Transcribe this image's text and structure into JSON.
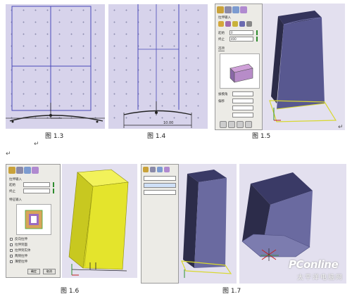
{
  "captions": {
    "fig13": "图 1.3",
    "fig14": "图 1.4",
    "fig15": "图 1.5",
    "fig16": "图 1.6",
    "fig17": "图 1.7"
  },
  "dimension_14": "10.00",
  "panel_15": {
    "sec_top": "拉伸输入",
    "label1": "起始",
    "label2": "终止",
    "value1": "0",
    "value2": "400",
    "tab": "选项",
    "row1": "拔模角",
    "row2": "偏移"
  },
  "panel_16": {
    "sec_top": "拉伸输入",
    "label1": "起始",
    "label2": "终止",
    "section_shape": "特征输入",
    "checkboxes": [
      "反向拉伸",
      "拉伸到面",
      "拉伸到实体",
      "两侧拉伸",
      "薄壁拉伸"
    ],
    "ok": "确定",
    "cancel": "取消"
  },
  "watermark": {
    "brand": "PConline",
    "sub": "太平洋电脑网"
  },
  "colors": {
    "grid_bg": "#d7d3eb",
    "solid_blue": "#5c5c8e",
    "solid_yellow": "#e8e82c",
    "sketch_line": "#4a4ab8"
  }
}
